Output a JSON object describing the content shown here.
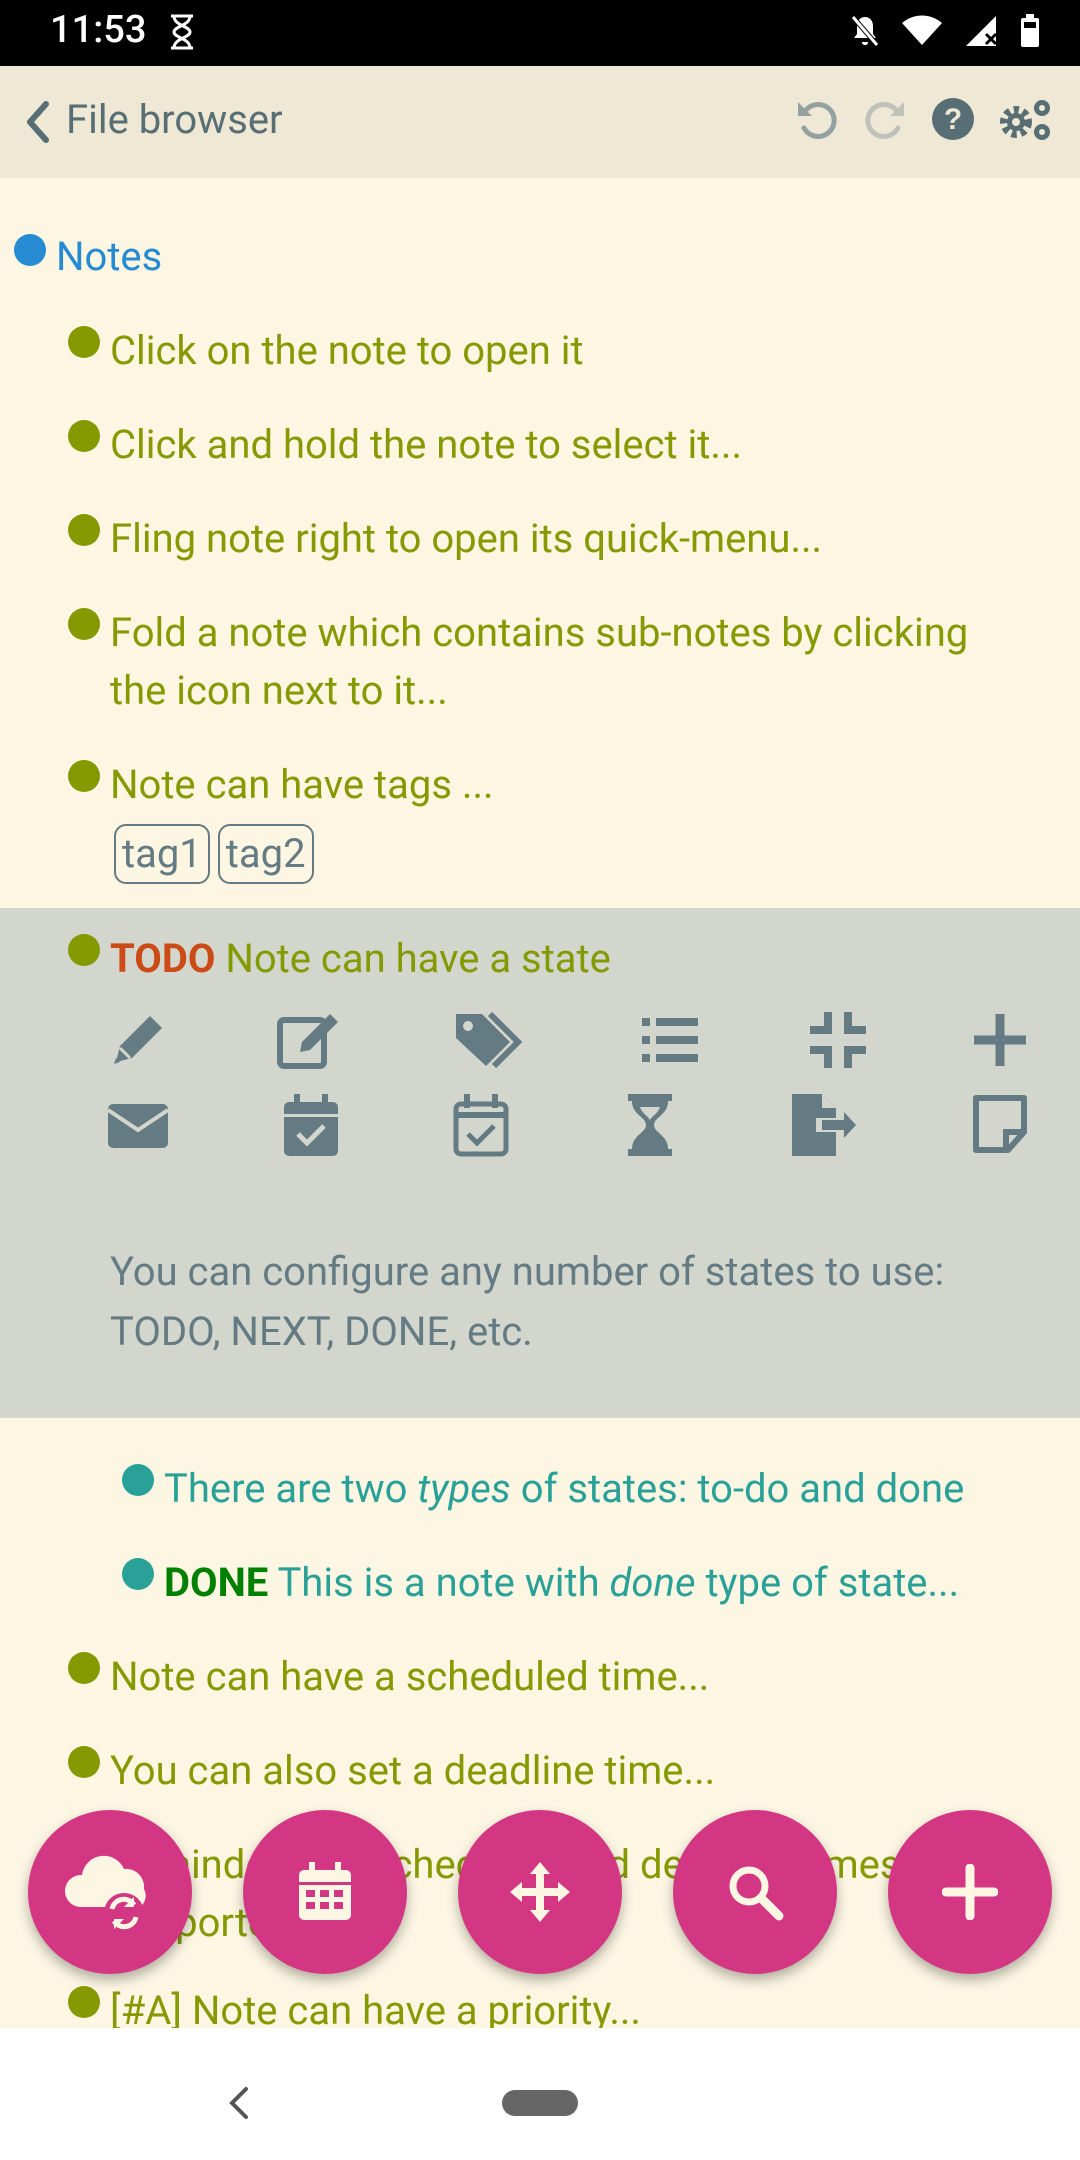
{
  "status": {
    "time": "11:53"
  },
  "toolbar": {
    "title": "File browser"
  },
  "notes": {
    "root": "Notes",
    "n1": "Click on the note to open it",
    "n2": "Click and hold the note to select it...",
    "n3": "Fling note right to open its quick-menu...",
    "n4a": "Fold a note which contains sub-notes by clicking",
    "n4b": "the icon next to it...",
    "n5": "Note can have tags ...",
    "tags": [
      "tag1",
      "tag2"
    ],
    "todo_state": "TODO",
    "n6": "Note can have a state",
    "state_desc_1": "You can configure any number of states to use:",
    "state_desc_2": "TODO, NEXT, DONE, etc.",
    "sub1_a": "There are two ",
    "sub1_em": "types",
    "sub1_b": " of states: to-do and done",
    "done_state": "DONE",
    "sub2_a": "This is a note with ",
    "sub2_em": "done",
    "sub2_b": " type of state...",
    "n7": "Note can have a scheduled time...",
    "n8": "You can also set a deadline time...",
    "n9a": "Reminders for scheduled and deadline times are",
    "n9b": "supported...",
    "n10": "[#A] Note can have a priority..."
  },
  "quick_menu_icons": [
    "pencil-icon",
    "edit-icon",
    "tags-icon",
    "list-icon",
    "compress-icon",
    "plus-icon",
    "envelope-icon",
    "calendar-check-icon",
    "calendar-check-outline-icon",
    "hourglass-icon",
    "file-export-icon",
    "sticky-note-icon"
  ],
  "fabs": [
    "cloud-sync",
    "calendar",
    "move",
    "search",
    "add"
  ],
  "colors": {
    "background": "#fdf6e3",
    "toolbar": "#eee8d5",
    "accent": "#d33682",
    "olive": "#859900",
    "teal": "#2aa198",
    "blue": "#268bd2",
    "todo": "#cb4b16",
    "done": "#008000",
    "selected": "#d3d6cd"
  }
}
